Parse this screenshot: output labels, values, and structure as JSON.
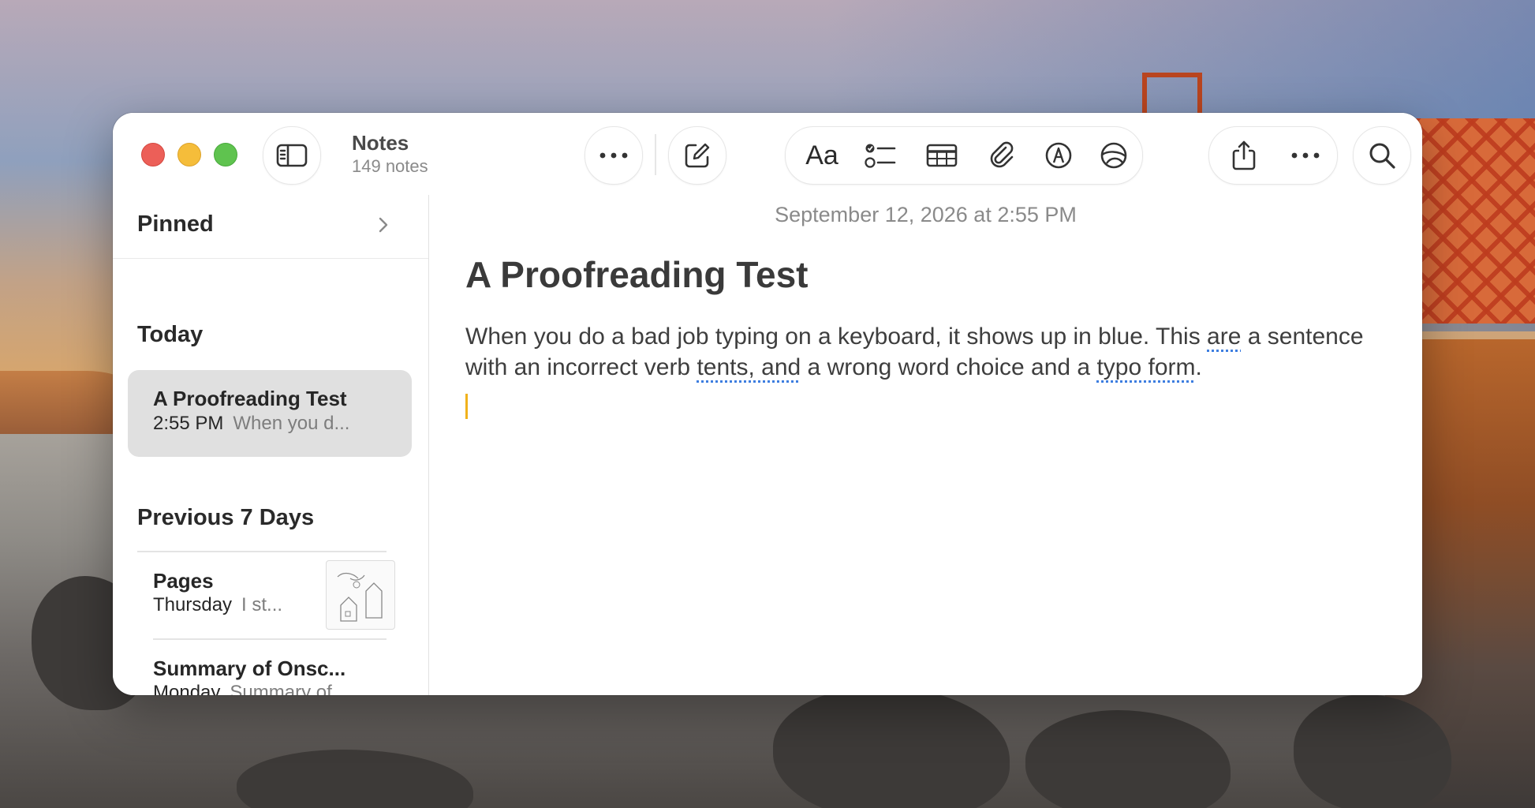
{
  "app": {
    "title": "Notes",
    "subtitle": "149 notes"
  },
  "toolbar": {
    "format_label": "Aa"
  },
  "sidebar": {
    "pinned_label": "Pinned",
    "sections": [
      {
        "label": "Today",
        "notes": [
          {
            "title": "A Proofreading Test",
            "time": "2:55 PM",
            "preview": "When you d..."
          }
        ]
      },
      {
        "label": "Previous 7 Days",
        "notes": [
          {
            "title": "Pages",
            "time": "Thursday",
            "preview": "I st..."
          },
          {
            "title": "Summary of Onsc...",
            "time": "Monday",
            "preview": "Summary of..."
          }
        ]
      }
    ]
  },
  "note": {
    "date": "September 12, 2026 at 2:55 PM",
    "title": "A Proofreading Test",
    "body": {
      "p1": "When you do a bad job typing on a keyboard, it shows up in blue. This ",
      "e1": "are",
      "p2": " a sentence with an incorrect verb ",
      "e2": "tents, and",
      "p3": " a wrong word choice and a ",
      "e3": "typo form",
      "p4": "."
    }
  },
  "colors": {
    "accent": "#f1b21b",
    "error_underline": "#3d7ee0",
    "selected_row": "#e0e0e0"
  }
}
